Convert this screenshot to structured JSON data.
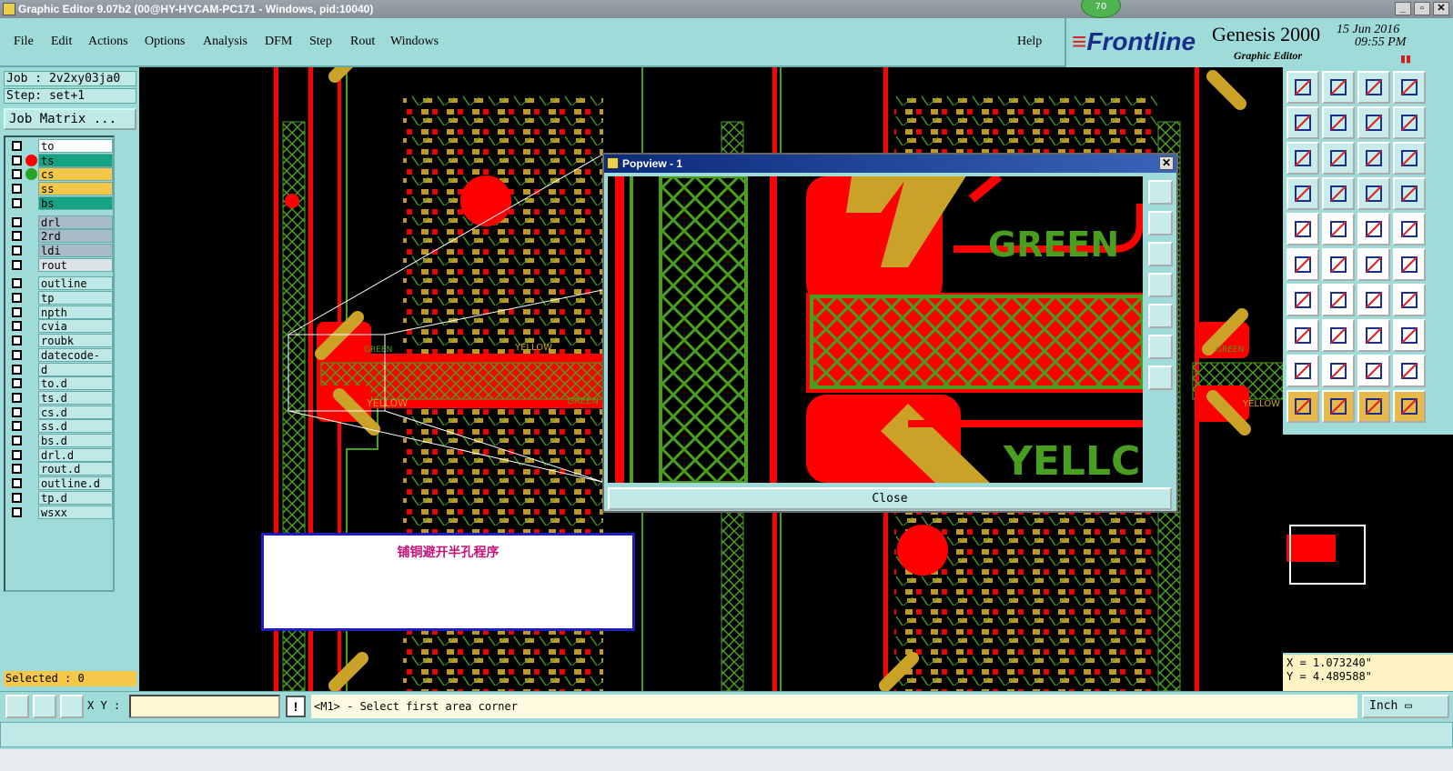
{
  "window": {
    "title": "Graphic Editor 9.07b2 (00@HY-HYCAM-PC171 - Windows, pid:10040)",
    "badge": "70"
  },
  "menu": {
    "file": "File",
    "edit": "Edit",
    "actions": "Actions",
    "options": "Options",
    "analysis": "Analysis",
    "dfm": "DFM",
    "step": "Step",
    "rout": "Rout",
    "windows": "Windows",
    "help": "Help"
  },
  "brand": {
    "logo": "Frontline",
    "product": "Genesis 2000",
    "module": "Graphic Editor",
    "date": "15 Jun 2016",
    "time": "09:55 PM"
  },
  "job": {
    "job_label": "Job : 2v2xy03ja0",
    "step_label": "Step: set+1",
    "matrix_button": "Job Matrix ..."
  },
  "layers": [
    {
      "name": "to",
      "color": "#ffffff"
    },
    {
      "name": "ts",
      "color": "#15a381",
      "status": "#ff0000"
    },
    {
      "name": "cs",
      "color": "#f5c84a",
      "status": "#2aa32a"
    },
    {
      "name": "ss",
      "color": "#f5c84a"
    },
    {
      "name": "bs",
      "color": "#15a381"
    },
    {
      "name": "drl",
      "color": "#a7bcc6"
    },
    {
      "name": "2rd",
      "color": "#a7bcc6"
    },
    {
      "name": "ldi",
      "color": "#a7bcc6"
    },
    {
      "name": "rout",
      "color": "#dce3e6"
    },
    {
      "name": "outline",
      "color": "#bfe9e6"
    },
    {
      "name": "tp",
      "color": "#bfe9e6"
    },
    {
      "name": "npth",
      "color": "#bfe9e6"
    },
    {
      "name": "cvia",
      "color": "#bfe9e6"
    },
    {
      "name": "roubk",
      "color": "#bfe9e6"
    },
    {
      "name": "datecode-cs",
      "color": "#bfe9e6"
    },
    {
      "name": "d",
      "color": "#bfe9e6"
    },
    {
      "name": "to.d",
      "color": "#bfe9e6"
    },
    {
      "name": "ts.d",
      "color": "#bfe9e6"
    },
    {
      "name": "cs.d",
      "color": "#bfe9e6"
    },
    {
      "name": "ss.d",
      "color": "#bfe9e6"
    },
    {
      "name": "bs.d",
      "color": "#bfe9e6"
    },
    {
      "name": "drl.d",
      "color": "#bfe9e6"
    },
    {
      "name": "rout.d",
      "color": "#bfe9e6"
    },
    {
      "name": "outline.d",
      "color": "#bfe9e6"
    },
    {
      "name": "tp.d",
      "color": "#bfe9e6"
    },
    {
      "name": "wsxx",
      "color": "#bfe9e6"
    }
  ],
  "selected_label": "Selected : 0",
  "canvas": {
    "label_green": "GREEN",
    "label_yellow": "YELLOW"
  },
  "popview": {
    "title": "Popview - 1",
    "close_label": "Close",
    "label_green": "GREEN",
    "label_yellow": "YELLC"
  },
  "note": {
    "text": "铺铜避开半孔程序"
  },
  "coords": {
    "x": "X = 1.073240\"",
    "y": "Y = 4.489588\""
  },
  "cmd": {
    "xy_label": "X Y :",
    "xy_value": "",
    "message": "<M1> - Select first area corner",
    "unit": "Inch"
  },
  "colors": {
    "copper": "#ff0000",
    "signal": "#c9a227",
    "trace": "#4a9e1f",
    "background": "#000000"
  }
}
